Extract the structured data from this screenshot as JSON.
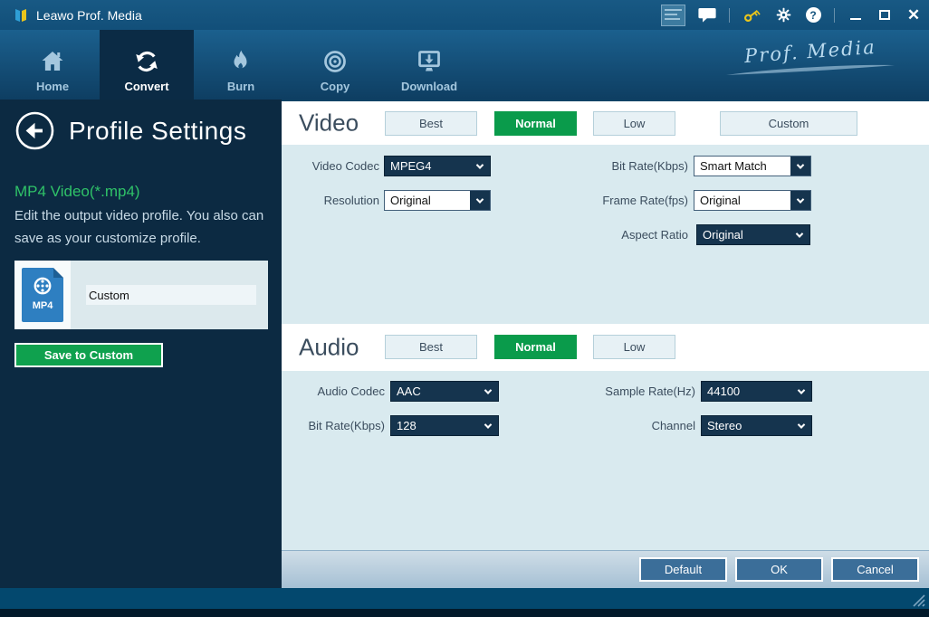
{
  "window": {
    "title": "Leawo Prof. Media"
  },
  "titlebar_icons": [
    "promo-banner-icon",
    "chat-bubble-icon",
    "key-icon",
    "gear-icon",
    "help-icon",
    "minimize-icon",
    "maximize-icon",
    "close-icon"
  ],
  "glyphs": {
    "help": "?",
    "close": "✕"
  },
  "nav": {
    "brand": "Prof. Media",
    "items": [
      {
        "label": "Home",
        "icon": "home-icon",
        "active": false
      },
      {
        "label": "Convert",
        "icon": "convert-sync-icon",
        "active": true
      },
      {
        "label": "Burn",
        "icon": "burn-flame-icon",
        "active": false
      },
      {
        "label": "Copy",
        "icon": "copy-disc-icon",
        "active": false
      },
      {
        "label": "Download",
        "icon": "download-monitor-icon",
        "active": false
      }
    ]
  },
  "panel": {
    "back_icon": "back-arrow-icon",
    "title": "Profile Settings",
    "profile_name": "MP4 Video(*.mp4)",
    "description": "Edit the output video profile. You also can save as your customize profile.",
    "profile_item": {
      "icon": "mp4-file-icon",
      "format_label": "MP4",
      "name_value": "Custom"
    },
    "save_button_label": "Save to Custom"
  },
  "video": {
    "title": "Video",
    "quality": [
      {
        "label": "Best",
        "active": false
      },
      {
        "label": "Normal",
        "active": true
      },
      {
        "label": "Low",
        "active": false
      },
      {
        "label": "Custom",
        "active": false
      }
    ],
    "fields": [
      {
        "label": "Video Codec",
        "value": "MPEG4",
        "variant": "dark"
      },
      {
        "label": "Bit Rate(Kbps)",
        "value": "Smart Match",
        "variant": "light"
      },
      {
        "label": "Resolution",
        "value": "Original",
        "variant": "light"
      },
      {
        "label": "Frame Rate(fps)",
        "value": "Original",
        "variant": "light"
      },
      {
        "label": "Aspect Ratio",
        "value": "Original",
        "variant": "dark"
      }
    ]
  },
  "audio": {
    "title": "Audio",
    "quality": [
      {
        "label": "Best",
        "active": false
      },
      {
        "label": "Normal",
        "active": true
      },
      {
        "label": "Low",
        "active": false
      }
    ],
    "fields": [
      {
        "label": "Audio Codec",
        "value": "AAC",
        "variant": "dark"
      },
      {
        "label": "Sample Rate(Hz)",
        "value": "44100",
        "variant": "dark"
      },
      {
        "label": "Bit Rate(Kbps)",
        "value": "128",
        "variant": "dark"
      },
      {
        "label": "Channel",
        "value": "Stereo",
        "variant": "dark"
      }
    ]
  },
  "dialog_buttons": {
    "default": "Default",
    "ok": "OK",
    "cancel": "Cancel"
  },
  "colors": {
    "titlebar_blue": "#14547e",
    "nav_gradient_top": "#1b608e",
    "nav_gradient_bottom": "#0e3e62",
    "active_tab_navy": "#0b2b45",
    "left_panel_navy": "#0c2a42",
    "section_light_blue": "#d9eaef",
    "accent_green": "#0a9b4b",
    "profile_name_green": "#2fc268",
    "dropdown_navy": "#15344e",
    "steel_button_blue": "#3b6e99",
    "footer_blue": "#03486e",
    "key_yellow": "#e9c51c"
  }
}
